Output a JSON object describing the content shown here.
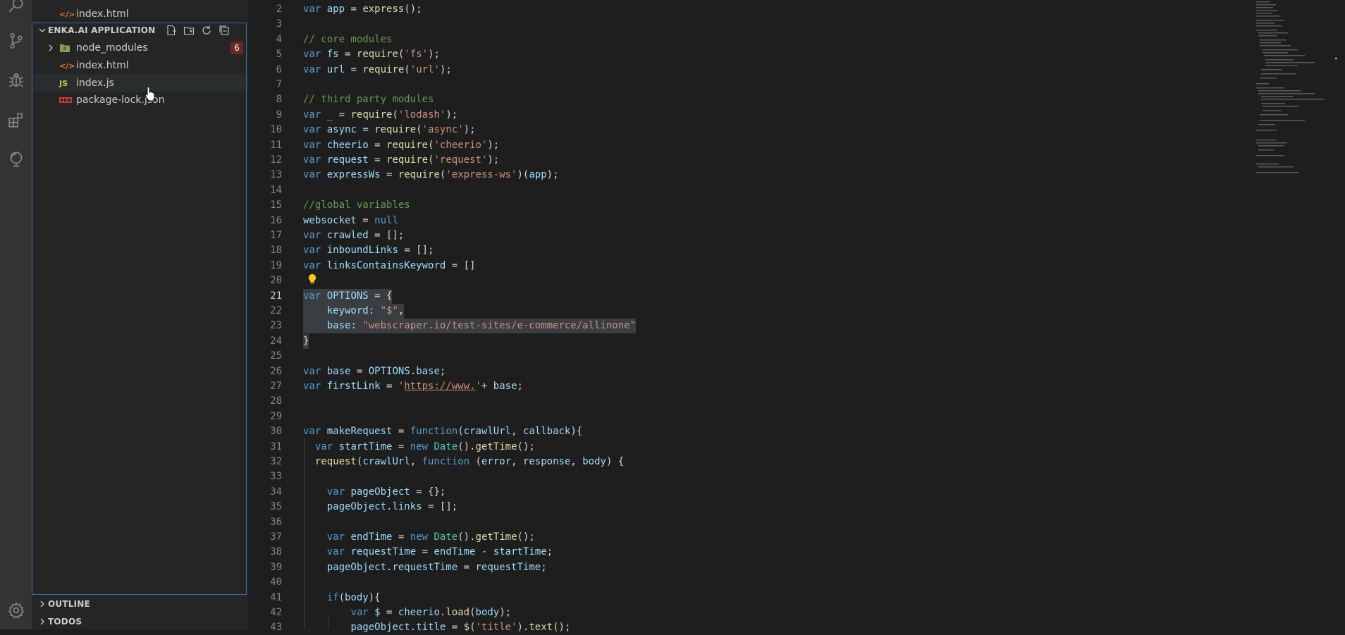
{
  "explorer": {
    "open_editor_file": "index.html",
    "folder": {
      "title": "ENKA.AI APPLICATION",
      "items": [
        {
          "name": "node_modules",
          "type": "folder",
          "badge": "6"
        },
        {
          "name": "index.html",
          "type": "html"
        },
        {
          "name": "index.js",
          "type": "js",
          "icon_text": "JS"
        },
        {
          "name": "package-lock.json",
          "type": "json"
        }
      ]
    },
    "sections": {
      "outline": "OUTLINE",
      "todos": "TODOS"
    }
  },
  "activity_bar": {
    "icons": [
      "search-icon",
      "source-control-icon",
      "debug-icon",
      "extensions-icon",
      "remote-explorer-icon",
      "gear-icon"
    ]
  },
  "editor": {
    "active_line": "21",
    "lines": [
      {
        "n": "2",
        "t": "var app = express();"
      },
      {
        "n": "3",
        "t": ""
      },
      {
        "n": "4",
        "t": "// core modules"
      },
      {
        "n": "5",
        "t": "var fs = require('fs');"
      },
      {
        "n": "6",
        "t": "var url = require('url');"
      },
      {
        "n": "7",
        "t": ""
      },
      {
        "n": "8",
        "t": "// third party modules"
      },
      {
        "n": "9",
        "t": "var _ = require('lodash');"
      },
      {
        "n": "10",
        "t": "var async = require('async');"
      },
      {
        "n": "11",
        "t": "var cheerio = require('cheerio');"
      },
      {
        "n": "12",
        "t": "var request = require('request');"
      },
      {
        "n": "13",
        "t": "var expressWs = require('express-ws')(app);"
      },
      {
        "n": "14",
        "t": ""
      },
      {
        "n": "15",
        "t": "//global variables"
      },
      {
        "n": "16",
        "t": "websocket = null"
      },
      {
        "n": "17",
        "t": "var crawled = [];"
      },
      {
        "n": "18",
        "t": "var inboundLinks = [];"
      },
      {
        "n": "19",
        "t": "var linksContainsKeyword = []"
      },
      {
        "n": "20",
        "t": ""
      },
      {
        "n": "21",
        "t": "var OPTIONS = {"
      },
      {
        "n": "22",
        "t": "    keyword: \"$\","
      },
      {
        "n": "23",
        "t": "    base: \"webscraper.io/test-sites/e-commerce/allinone\""
      },
      {
        "n": "24",
        "t": "}"
      },
      {
        "n": "25",
        "t": ""
      },
      {
        "n": "26",
        "t": "var base = OPTIONS.base;"
      },
      {
        "n": "27",
        "t": "var firstLink = 'https://www.'+ base;"
      },
      {
        "n": "28",
        "t": ""
      },
      {
        "n": "29",
        "t": ""
      },
      {
        "n": "30",
        "t": "var makeRequest = function(crawlUrl, callback){"
      },
      {
        "n": "31",
        "t": "  var startTime = new Date().getTime();"
      },
      {
        "n": "32",
        "t": "  request(crawlUrl, function (error, response, body) {"
      },
      {
        "n": "33",
        "t": ""
      },
      {
        "n": "34",
        "t": "    var pageObject = {};"
      },
      {
        "n": "35",
        "t": "    pageObject.links = [];"
      },
      {
        "n": "36",
        "t": ""
      },
      {
        "n": "37",
        "t": "    var endTime = new Date().getTime();"
      },
      {
        "n": "38",
        "t": "    var requestTime = endTime - startTime;"
      },
      {
        "n": "39",
        "t": "    pageObject.requestTime = requestTime;"
      },
      {
        "n": "40",
        "t": ""
      },
      {
        "n": "41",
        "t": "    if(body){"
      },
      {
        "n": "42",
        "t": "        var $ = cheerio.load(body);"
      },
      {
        "n": "43",
        "t": "        pageObject.title = $('title').text();"
      }
    ]
  }
}
